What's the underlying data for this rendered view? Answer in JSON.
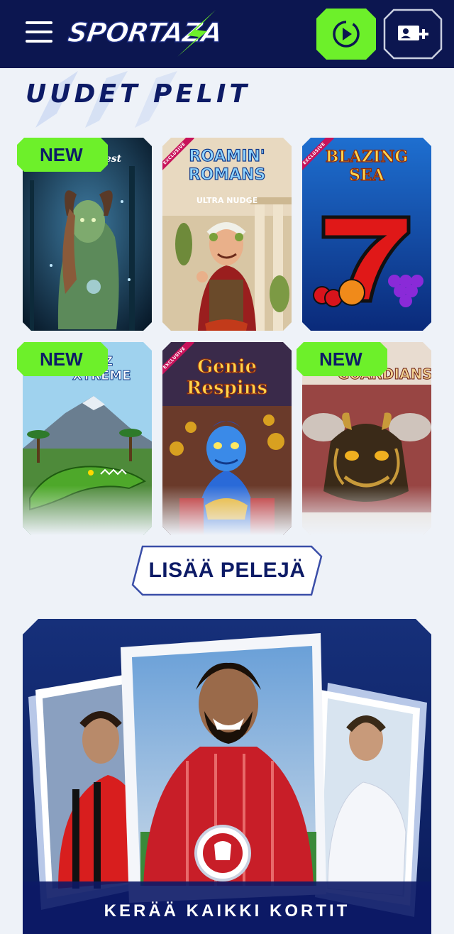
{
  "header": {
    "logo_text": "SPORTAZA",
    "menu_icon": "hamburger-menu-icon",
    "play_icon": "play-circle-icon",
    "account_icon": "add-account-icon",
    "colors": {
      "background": "#0c1650",
      "accent": "#6df02a"
    }
  },
  "section": {
    "title": "UUDET PELIT"
  },
  "games": [
    {
      "title": "Forest",
      "subtitle": "",
      "new_badge": "NEW",
      "exclusive": "",
      "theme": "forest-elf"
    },
    {
      "title": "ROAMIN' ROMANS",
      "subtitle": "ULTRA NUDGE",
      "new_badge": "",
      "exclusive": "EXCLUSIVE",
      "theme": "roman-emperor"
    },
    {
      "title": "BLAZING SEA",
      "subtitle": "",
      "new_badge": "",
      "exclusive": "EXCLUSIVE",
      "theme": "lucky-seven"
    },
    {
      "title": "BLITZ XTREME",
      "subtitle": "",
      "new_badge": "NEW",
      "exclusive": "",
      "theme": "crocodile-jungle"
    },
    {
      "title": "Genie Respins",
      "subtitle": "",
      "new_badge": "",
      "exclusive": "EXCLUSIVE",
      "theme": "genie"
    },
    {
      "title": "GUARDIANS",
      "subtitle": "",
      "new_badge": "NEW",
      "exclusive": "",
      "theme": "dragon-guardian"
    }
  ],
  "more_button": {
    "label": "LISÄÄ PELEJÄ"
  },
  "promo_banner": {
    "caption": "KERÄÄ KAIKKI KORTIT"
  }
}
